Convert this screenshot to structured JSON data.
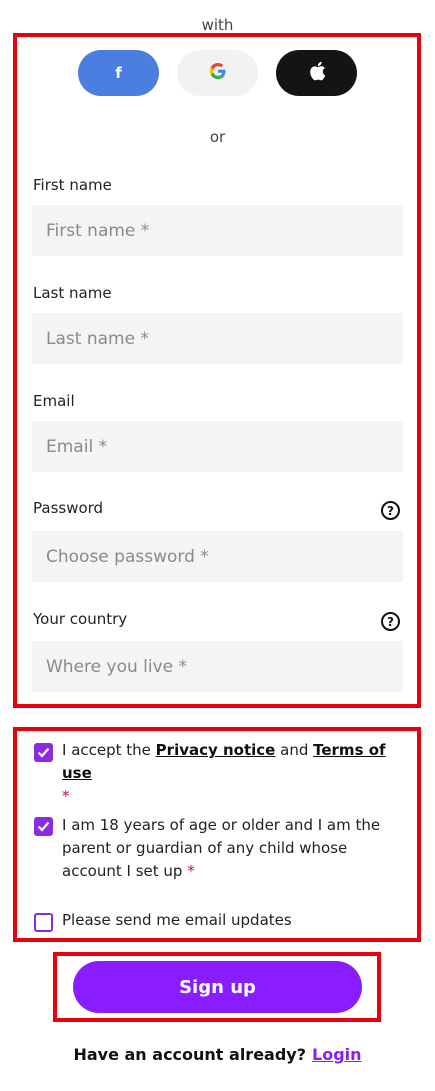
{
  "header": {
    "with_text": "with"
  },
  "social": {
    "facebook_glyph": "f",
    "google_glyph": "G",
    "facebook_icon": "facebook-icon",
    "google_icon": "google-icon",
    "apple_icon": "apple-icon"
  },
  "or_text": "or",
  "form": {
    "first_name": {
      "label": "First name",
      "placeholder": "First name *",
      "value": ""
    },
    "last_name": {
      "label": "Last name",
      "placeholder": "Last name *",
      "value": ""
    },
    "email": {
      "label": "Email",
      "placeholder": "Email *",
      "value": ""
    },
    "password": {
      "label": "Password",
      "placeholder": "Choose password *",
      "value": "",
      "help_glyph": "?"
    },
    "country": {
      "label": "Your country",
      "placeholder": "Where you live *",
      "value": "",
      "help_glyph": "?"
    }
  },
  "consents": {
    "privacy": {
      "checked": true,
      "text_before": "I accept the ",
      "privacy_link": "Privacy notice",
      "text_mid": " and ",
      "terms_link": "Terms of use",
      "required_mark": "*"
    },
    "age": {
      "checked": true,
      "text": "I am 18 years of age or older and I am the parent or guardian of any child whose account I set up",
      "required_mark": "*"
    },
    "updates": {
      "checked": false,
      "text": "Please send me email updates"
    }
  },
  "signup_button": {
    "label": "Sign up"
  },
  "footer": {
    "prompt": "Have an account already?",
    "login_link": "Login"
  },
  "colors": {
    "accent_purple": "#8a1dff",
    "checkbox_purple": "#8a2be2",
    "facebook_blue": "#4a7fe0",
    "apple_black": "#141414",
    "highlight_red": "#e8000b",
    "required_red": "#d6004c"
  }
}
